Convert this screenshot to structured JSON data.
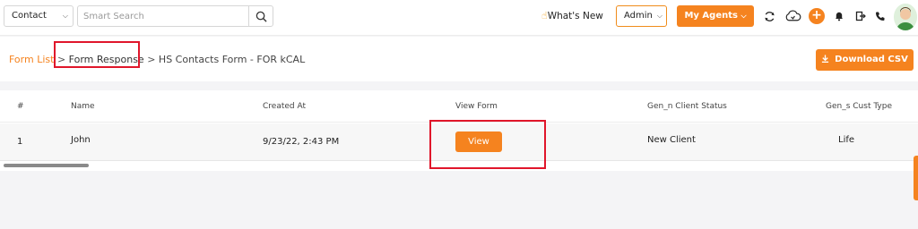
{
  "topbar": {
    "entity_select": "Contact",
    "search_placeholder": "Smart Search",
    "whats_new": "What's New",
    "admin_select": "Admin",
    "my_agents": "My Agents"
  },
  "breadcrumb": {
    "form_list": "Form List",
    "separator": ">",
    "form_response": "Form Response",
    "form_name": "HS Contacts Form - FOR kCAL"
  },
  "actions": {
    "download_csv": "Download CSV"
  },
  "table": {
    "headers": [
      "#",
      "Name",
      "Created At",
      "View Form",
      "Gen_n Client Status",
      "Gen_s Cust Type"
    ],
    "rows": [
      {
        "index": "1",
        "name": "John",
        "created_at": "9/23/22, 2:43 PM",
        "view_label": "View",
        "client_status": "New Client",
        "cust_type": "Life"
      }
    ]
  },
  "colors": {
    "accent": "#f5831f",
    "highlight": "#e0162b"
  },
  "icons": [
    "chevron-down-icon",
    "search-icon",
    "hand-icon",
    "refresh-icon",
    "cloud-icon",
    "plus-icon",
    "bell-icon",
    "logout-icon",
    "phone-icon",
    "avatar",
    "download-icon"
  ]
}
